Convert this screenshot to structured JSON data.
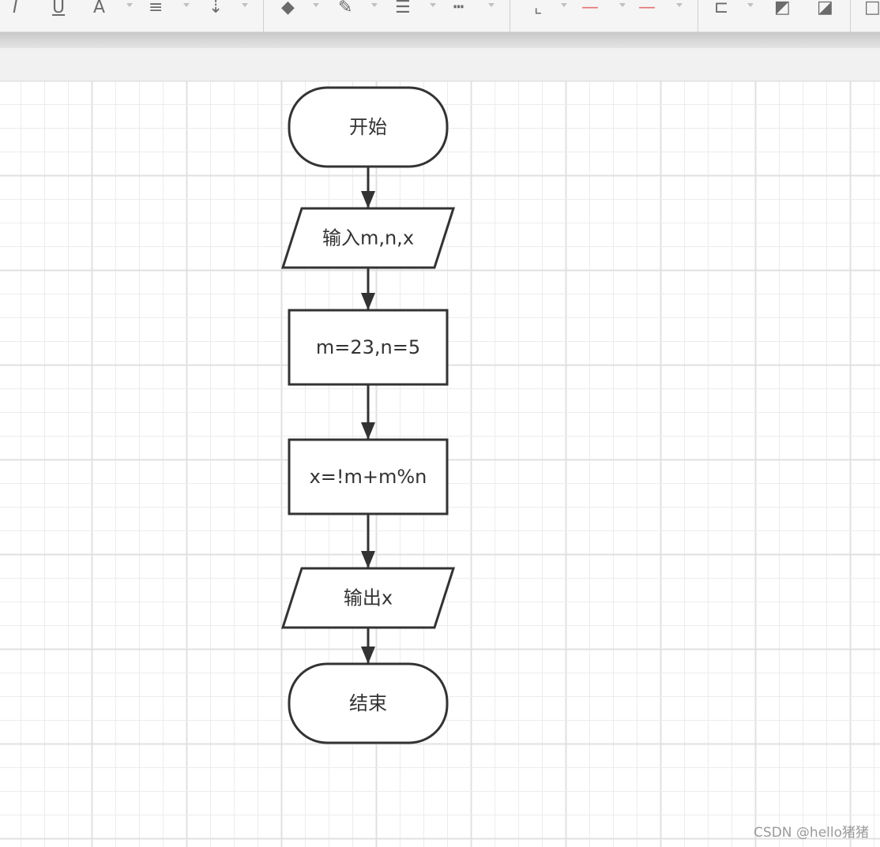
{
  "toolbar": {
    "icons": [
      "italic-icon",
      "underline-icon",
      "font-color-icon",
      "align-icon",
      "line-spacing-icon",
      "fill-color-icon",
      "line-color-icon",
      "line-width-icon",
      "line-style-icon",
      "connector-icon",
      "start-arrow-icon",
      "end-arrow-icon",
      "align-objects-icon",
      "bring-front-icon",
      "send-back-icon"
    ]
  },
  "diagram": {
    "nodes": [
      {
        "id": "start",
        "shape": "terminator",
        "label": "开始"
      },
      {
        "id": "input",
        "shape": "parallelogram",
        "label": "输入m,n,x"
      },
      {
        "id": "assign",
        "shape": "rect",
        "label": "m=23,n=5"
      },
      {
        "id": "compute",
        "shape": "rect",
        "label": "x=!m+m%n"
      },
      {
        "id": "output",
        "shape": "parallelogram",
        "label": "输出x"
      },
      {
        "id": "end",
        "shape": "terminator",
        "label": "结束"
      }
    ],
    "edges": [
      {
        "from": "start",
        "to": "input"
      },
      {
        "from": "input",
        "to": "assign"
      },
      {
        "from": "assign",
        "to": "compute"
      },
      {
        "from": "compute",
        "to": "output"
      },
      {
        "from": "output",
        "to": "end"
      }
    ]
  },
  "watermark": "CSDN @hello猪猪",
  "colors": {
    "stroke": "#333333",
    "text": "#333333",
    "grid_minor": "#ececec",
    "grid_major": "#e0e0e0"
  }
}
